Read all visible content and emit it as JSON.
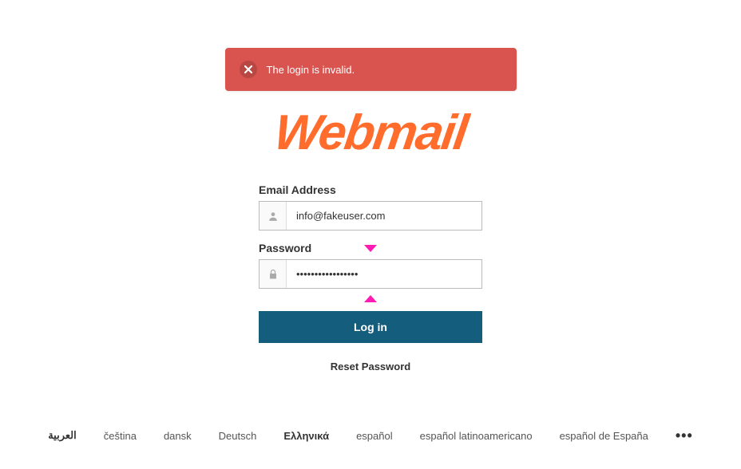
{
  "alert": {
    "message": "The login is invalid."
  },
  "logo": {
    "text": "Webmail"
  },
  "form": {
    "email_label": "Email Address",
    "email_value": "info@fakeuser.com",
    "email_placeholder": "",
    "password_label": "Password",
    "password_value": "•••••••••••••••••",
    "password_placeholder": "",
    "login_label": "Log in",
    "reset_label": "Reset Password"
  },
  "languages": {
    "items": [
      {
        "label": "العربية",
        "bold": true
      },
      {
        "label": "čeština",
        "bold": false
      },
      {
        "label": "dansk",
        "bold": false
      },
      {
        "label": "Deutsch",
        "bold": false
      },
      {
        "label": "Ελληνικά",
        "bold": true
      },
      {
        "label": "español",
        "bold": false
      },
      {
        "label": "español latinoamericano",
        "bold": false
      },
      {
        "label": "español de España",
        "bold": false
      }
    ],
    "more": "…"
  }
}
